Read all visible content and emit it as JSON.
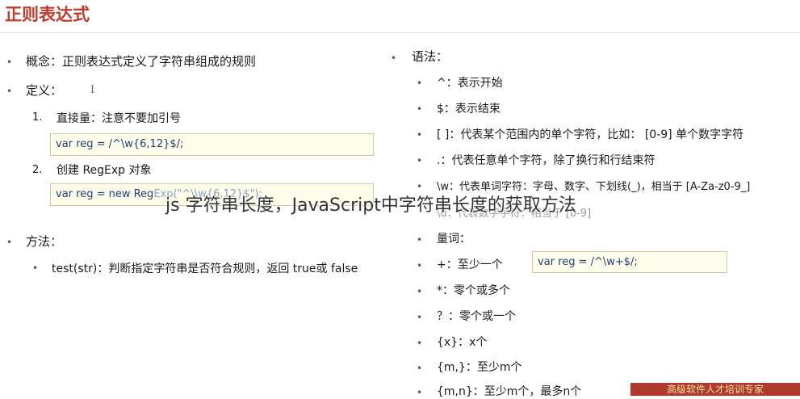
{
  "title": "正则表达式",
  "left": {
    "concept": "概念：正则表达式定义了字符串组成的规则",
    "definition": "定义：",
    "item1": "直接量：注意不要加引号",
    "code1": "var reg = /^\\w{6,12}$/;",
    "item2": "创建 RegExp 对象",
    "code2_a": "var reg = new Reg",
    "code2_b": "Exp(\"^\\\\w{6,12}$\");",
    "method": "方法：",
    "test": "test(str)：判断指定字符串是否符合规则，返回 true或 false"
  },
  "right": {
    "syntax": "语法：",
    "caret": "^：表示开始",
    "dollar": "$：表示结束",
    "bracket": "[ ]：代表某个范围内的单个字符，比如： [0-9] 单个数字字符",
    "dot": ".：代表任意单个字符，除了换行和行结束符",
    "w": "\\w：代表单词字符：字母、数字、下划线(_)，相当于 [A-Za-z0-9_]",
    "d_ghost": "\\d：代表数字字符：相当于 [0-9]",
    "quant": "量词：",
    "plus": "+：至少一个",
    "plus_code": "var reg = /^\\w+$/;",
    "star": "*：零个或多个",
    "question": "？：零个或一个",
    "x": "{x}：x个",
    "m": "{m,}：至少m个",
    "mn": "{m,n}：至少m个，最多n个"
  },
  "overlay": "js 字符串长度，JavaScript中字符串长度的获取方法",
  "watermark": "高级软件人才培训专家"
}
